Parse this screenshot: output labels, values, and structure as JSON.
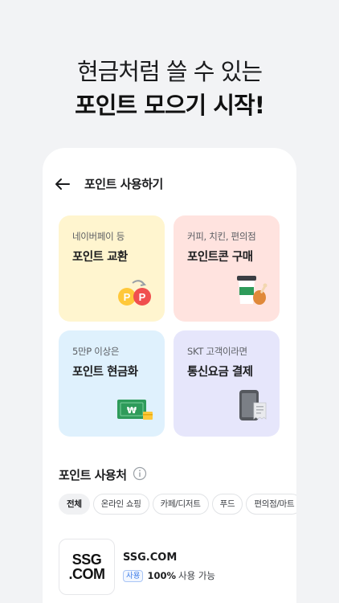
{
  "headline": {
    "line1": "현금처럼 쓸 수 있는",
    "line2": "포인트 모으기 시작!"
  },
  "appbar": {
    "title": "포인트 사용하기",
    "back_icon": "arrow-left-icon"
  },
  "cards": [
    {
      "sub": "네이버페이 등",
      "main": "포인트 교환",
      "icon": "point-exchange-icon"
    },
    {
      "sub": "커피, 치킨, 편의점",
      "main": "포인트콘 구매",
      "icon": "coffee-chicken-icon"
    },
    {
      "sub": "5만P 이상은",
      "main": "포인트 현금화",
      "icon": "cash-icon"
    },
    {
      "sub": "SKT 고객이라면",
      "main": "통신요금 결제",
      "icon": "phone-bill-icon"
    }
  ],
  "usage": {
    "title": "포인트 사용처",
    "info_icon": "info-icon",
    "chips": [
      "전체",
      "온라인 쇼핑",
      "카페/디저트",
      "푸드",
      "편의점/마트"
    ]
  },
  "store": {
    "logo_line1": "SSG",
    "logo_line2": ".COM",
    "name": "SSG.COM",
    "badge": "사용",
    "percent": "100%",
    "usage_text": "사용 가능"
  },
  "colors": {
    "card_yellow": "#fff5cf",
    "card_pink": "#ffe3df",
    "card_blue": "#dff1fd",
    "card_purple": "#e6e6fb",
    "accent_blue": "#3c7be8"
  }
}
